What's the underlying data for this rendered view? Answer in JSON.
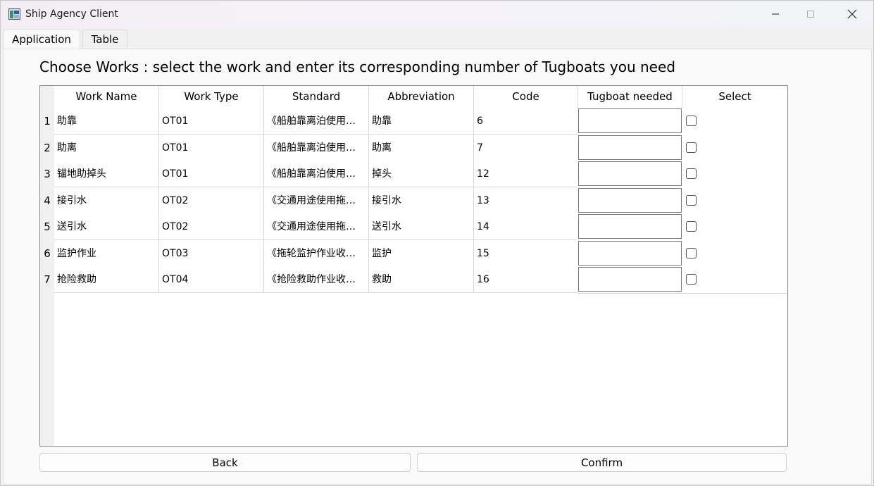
{
  "window": {
    "title": "Ship Agency Client"
  },
  "menu": {
    "tabs": [
      {
        "label": "Application"
      },
      {
        "label": "Table"
      }
    ]
  },
  "page": {
    "heading": "Choose Works : select the work and enter its corresponding number of Tugboats you need"
  },
  "table": {
    "columns": [
      "Work Name",
      "Work Type",
      "Standard",
      "Abbreviation",
      "Code",
      "Tugboat needed",
      "Select"
    ],
    "rows": [
      {
        "num": "1",
        "name": "助靠",
        "type": "OT01",
        "standard": "《船舶靠离泊使用…",
        "abbr": "助靠",
        "code": "6",
        "tugboats": "",
        "selected": false
      },
      {
        "num": "2",
        "name": "助离",
        "type": "OT01",
        "standard": "《船舶靠离泊使用…",
        "abbr": "助离",
        "code": "7",
        "tugboats": "",
        "selected": false
      },
      {
        "num": "3",
        "name": "锚地助掉头",
        "type": "OT01",
        "standard": "《船舶靠离泊使用…",
        "abbr": "掉头",
        "code": "12",
        "tugboats": "",
        "selected": false
      },
      {
        "num": "4",
        "name": "接引水",
        "type": "OT02",
        "standard": "《交通用途使用拖…",
        "abbr": "接引水",
        "code": "13",
        "tugboats": "",
        "selected": false
      },
      {
        "num": "5",
        "name": "送引水",
        "type": "OT02",
        "standard": "《交通用途使用拖…",
        "abbr": "送引水",
        "code": "14",
        "tugboats": "",
        "selected": false
      },
      {
        "num": "6",
        "name": "监护作业",
        "type": "OT03",
        "standard": "《拖轮监护作业收…",
        "abbr": "监护",
        "code": "15",
        "tugboats": "",
        "selected": false
      },
      {
        "num": "7",
        "name": "抢险救助",
        "type": "OT04",
        "standard": "《抢险救助作业收…",
        "abbr": "救助",
        "code": "16",
        "tugboats": "",
        "selected": false
      }
    ]
  },
  "buttons": {
    "back": "Back",
    "confirm": "Confirm"
  },
  "icons": {
    "app": "app-icon",
    "minimize": "minimize-icon",
    "maximize": "maximize-icon",
    "close": "close-icon"
  }
}
